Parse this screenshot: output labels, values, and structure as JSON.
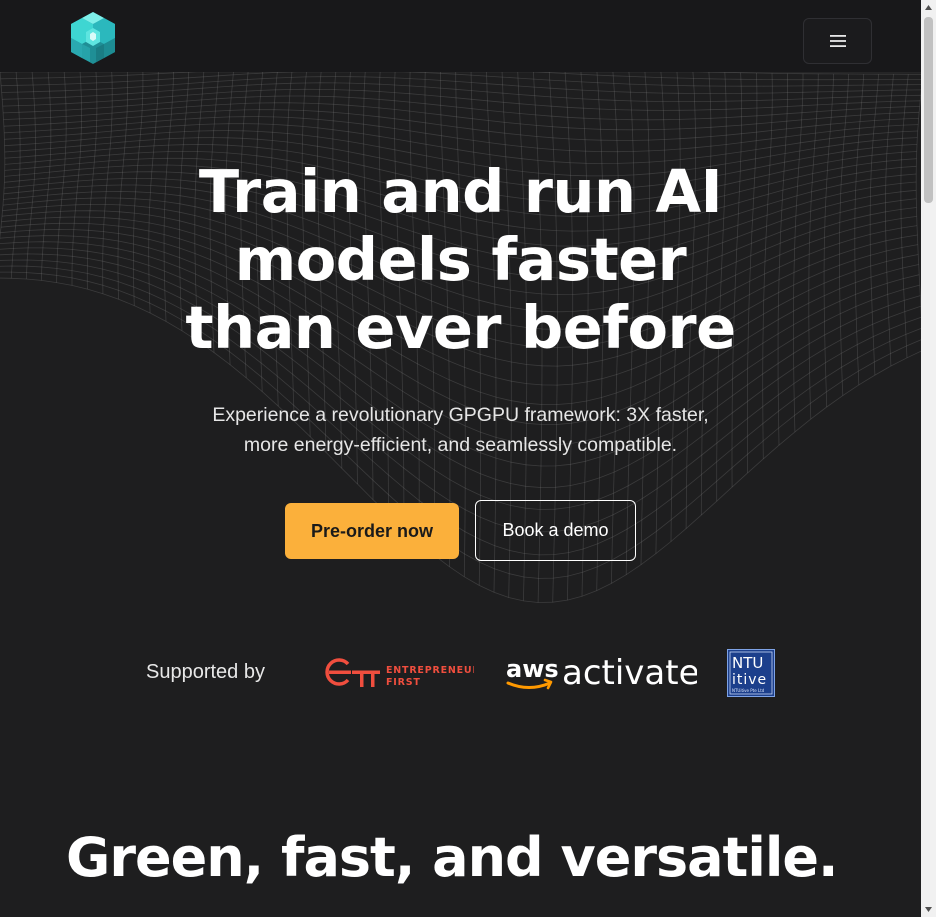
{
  "navbar": {
    "logo_icon": "cube-m-logo",
    "menu_icon": "hamburger-icon"
  },
  "hero": {
    "title_lines": [
      "Train and run AI",
      "models faster",
      "than ever before"
    ],
    "subtitle_lines": [
      "Experience a revolutionary GPGPU framework: 3X faster,",
      "more energy-efficient, and seamlessly compatible."
    ],
    "primary_cta": "Pre-order now",
    "secondary_cta": "Book a demo"
  },
  "supported": {
    "label": "Supported by",
    "ef_line1": "ENTREPRENEUR",
    "ef_line2": "FIRST",
    "aws_small": "aws",
    "aws_large": "activate",
    "ntu_top": "NTU",
    "ntu_mid": "itive",
    "ntu_bottom": "NTUitive Pte Ltd"
  },
  "section": {
    "title": "Green, fast, and versatile."
  },
  "colors": {
    "background": "#1e1e1f",
    "accent": "#fbb03b",
    "logo_teal": "#3ed6d2",
    "ef_red": "#f04e3e",
    "ntu_blue": "#1c3f8c"
  }
}
